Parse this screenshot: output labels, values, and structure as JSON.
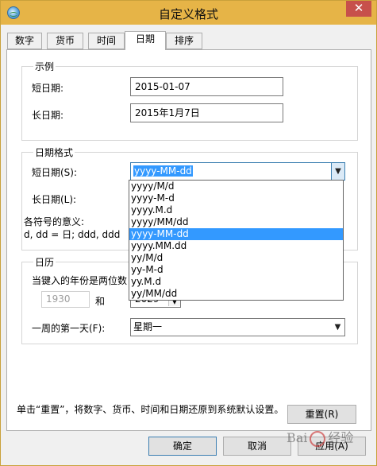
{
  "window": {
    "title": "自定义格式",
    "close_symbol": "✕"
  },
  "tabs": [
    {
      "label": "数字",
      "active": false
    },
    {
      "label": "货币",
      "active": false
    },
    {
      "label": "时间",
      "active": false
    },
    {
      "label": "日期",
      "active": true
    },
    {
      "label": "排序",
      "active": false
    }
  ],
  "example": {
    "legend": "示例",
    "short_label": "短日期:",
    "short_value": "2015-01-07",
    "long_label": "长日期:",
    "long_value": "2015年1月7日"
  },
  "date_format": {
    "legend": "日期格式",
    "short_label": "短日期(S):",
    "short_value": "yyyy-MM-dd",
    "long_label": "长日期(L):",
    "meaning_label": "各符号的意义:",
    "meaning_text": "d, dd = 日;  ddd, ddd",
    "dropdown_options": [
      "yyyy/M/d",
      "yyyy-M-d",
      "yyyy.M.d",
      "yyyy/MM/dd",
      "yyyy-MM-dd",
      "yyyy.MM.dd",
      "yy/M/d",
      "yy-M-d",
      "yy.M.d",
      "yy/MM/dd"
    ],
    "selected_index": 4
  },
  "calendar": {
    "legend": "日历",
    "two_digit_label": "当键入的年份是两位数",
    "year_from": "1930",
    "and_label": "和",
    "year_to": "2029",
    "first_day_label": "一周的第一天(F):",
    "first_day_value": "星期一"
  },
  "footer": {
    "note_line1": "单击“重置”，将数字、货币、时间和日期还原到系统默认设置。",
    "reset_label": "重置(R)"
  },
  "buttons": {
    "ok": "确定",
    "cancel": "取消",
    "apply": "应用(A)"
  },
  "watermark": {
    "text_left": "Bai",
    "text_right": "经验"
  }
}
